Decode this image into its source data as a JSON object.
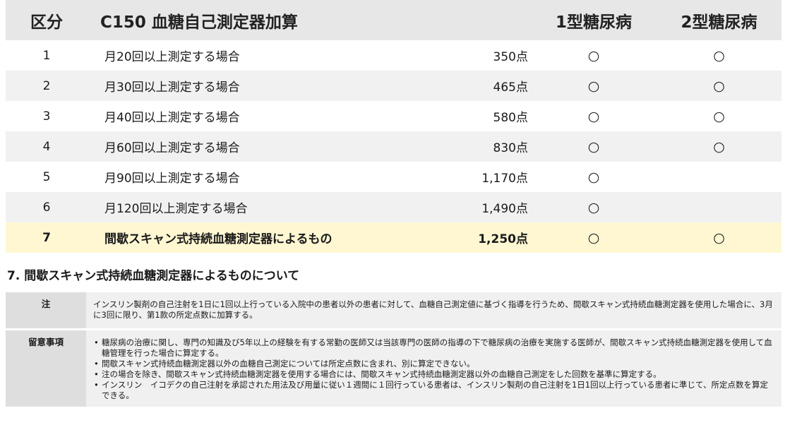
{
  "table": {
    "headers": {
      "kubun": "区分",
      "title": "C150 血糖自己測定器加算",
      "points": "",
      "type1": "1型糖尿病",
      "type2": "2型糖尿病"
    },
    "rows": [
      {
        "no": "1",
        "desc": "月20回以上測定する場合",
        "points": "350点",
        "type1": "○",
        "type2": "○"
      },
      {
        "no": "2",
        "desc": "月30回以上測定する場合",
        "points": "465点",
        "type1": "○",
        "type2": "○"
      },
      {
        "no": "3",
        "desc": "月40回以上測定する場合",
        "points": "580点",
        "type1": "○",
        "type2": "○"
      },
      {
        "no": "4",
        "desc": "月60回以上測定する場合",
        "points": "830点",
        "type1": "○",
        "type2": "○"
      },
      {
        "no": "5",
        "desc": "月90回以上測定する場合",
        "points": "1,170点",
        "type1": "○",
        "type2": ""
      },
      {
        "no": "6",
        "desc": "月120回以上測定する場合",
        "points": "1,490点",
        "type1": "○",
        "type2": ""
      },
      {
        "no": "7",
        "desc": "間歇スキャン式持続血糖測定器によるもの",
        "points": "1,250点",
        "type1": "○",
        "type2": "○"
      }
    ]
  },
  "section": {
    "title": "7. 間歇スキャン式持続血糖測定器によるものについて"
  },
  "notes": {
    "note_label": "注",
    "note_text": "インスリン製剤の自己注射を1日に1回以上行っている入院中の患者以外の患者に対して、血糖自己測定値に基づく指導を行うため、間歇スキャン式持続血糖測定器を使用した場合に、3月に3回に限り、第1款の所定点数に加算する。",
    "remarks_label": "留意事項",
    "remarks": [
      "糖尿病の治療に関し、専門の知識及び5年以上の経験を有する常勤の医師又は当該専門の医師の指導の下で糖尿病の治療を実施する医師が、間歇スキャン式持続血糖測定器を使用して血糖管理を行った場合に算定する。",
      "間歇スキャン式持続血糖測定器以外の血糖自己測定については所定点数に含まれ、別に算定できない。",
      "注の場合を除き、間歇スキャン式持続血糖測定器を使用する場合には、間歇スキャン式持続血糖測定器以外の血糖自己測定をした回数を基準に算定する。",
      "インスリン　イコデクの自己注射を承認された用法及び用量に従い１週間に１回行っている患者は、インスリン製剤の自己注射を1日1回以上行っている患者に準じて、所定点数を算定できる。"
    ]
  }
}
